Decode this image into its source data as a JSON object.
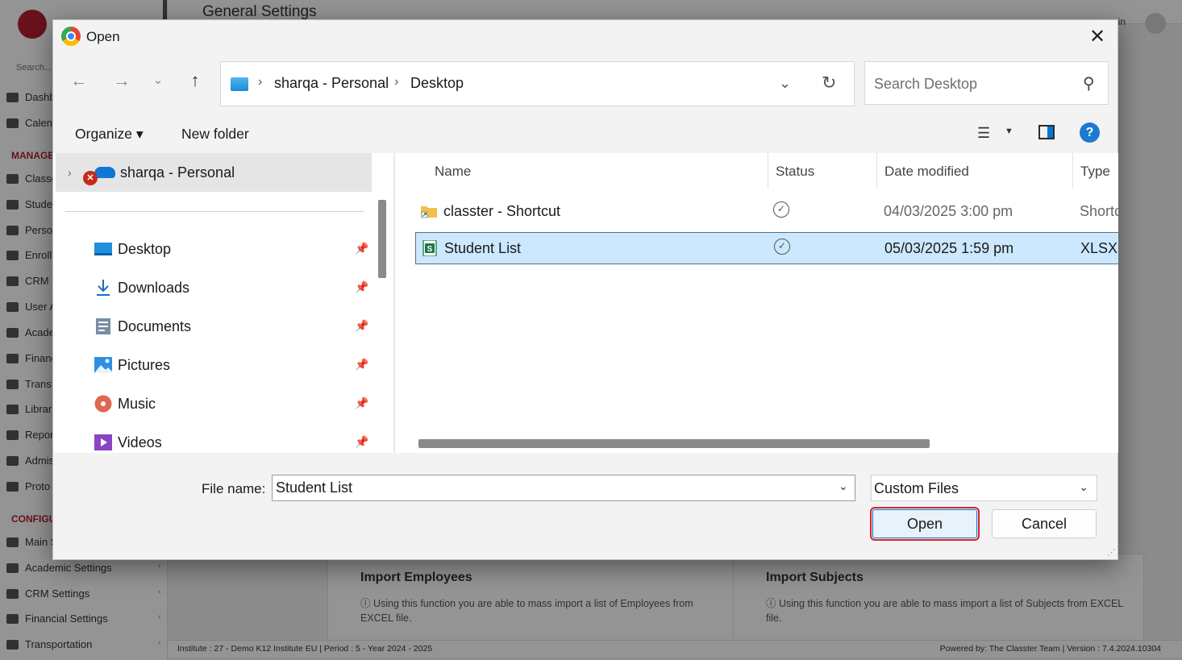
{
  "background": {
    "header_title": "General Settings",
    "search_label": "Search...",
    "admin_label": "nin",
    "sections": [
      "MANAGE",
      "CONFIGU"
    ],
    "nav_items": [
      "Dashb",
      "Calen",
      "Classe",
      "Stude",
      "Perso",
      "Enroll",
      "CRM",
      "User A",
      "Acade",
      "Financ",
      "Trans",
      "Librar",
      "Repor",
      "Admis",
      "Proto",
      "Main S",
      "Academic Settings",
      "CRM Settings",
      "Financial Settings",
      "Transportation"
    ],
    "cards": [
      {
        "title": "Import Employees",
        "text": "ⓘ  Using this function you are able to mass import a list of Employees from EXCEL file."
      },
      {
        "title": "Import Subjects",
        "text": "ⓘ  Using this function you are able to mass import a list of Subjects from EXCEL file."
      }
    ],
    "footer_left": "Institute : 27 - Demo K12 Institute EU  |  Period : 5 - Year 2024 - 2025",
    "footer_right": "Powered by: The Classter Team  |  Version : 7.4.2024.10304"
  },
  "dialog": {
    "title": "Open",
    "address": {
      "crumbs": [
        "sharqa - Personal",
        "Desktop"
      ]
    },
    "search_placeholder": "Search Desktop",
    "commands": {
      "organize": "Organize ▾",
      "new_folder": "New folder"
    },
    "nav_pane": {
      "root": "sharqa - Personal",
      "items": [
        {
          "label": "Desktop",
          "icon": "desktop-icon"
        },
        {
          "label": "Downloads",
          "icon": "downloads-icon"
        },
        {
          "label": "Documents",
          "icon": "documents-icon"
        },
        {
          "label": "Pictures",
          "icon": "pictures-icon"
        },
        {
          "label": "Music",
          "icon": "music-icon"
        },
        {
          "label": "Videos",
          "icon": "videos-icon"
        }
      ]
    },
    "columns": {
      "name": "Name",
      "status": "Status",
      "date": "Date modified",
      "type": "Type"
    },
    "files": [
      {
        "name": "classter - Shortcut",
        "status": "✓",
        "date": "04/03/2025 3:00 pm",
        "type": "Shortcut",
        "selected": false
      },
      {
        "name": "Student List",
        "status": "✓",
        "date": "05/03/2025 1:59 pm",
        "type": "XLSX Worksheet",
        "selected": true
      }
    ],
    "file_name_label": "File name:",
    "file_name_value": "Student List",
    "file_type_value": "Custom Files",
    "open_label": "Open",
    "cancel_label": "Cancel"
  },
  "colors": {
    "accent": "#0078d4",
    "selection": "#cce8ff",
    "highlight_border": "#d8232a",
    "brand": "#b32034"
  }
}
